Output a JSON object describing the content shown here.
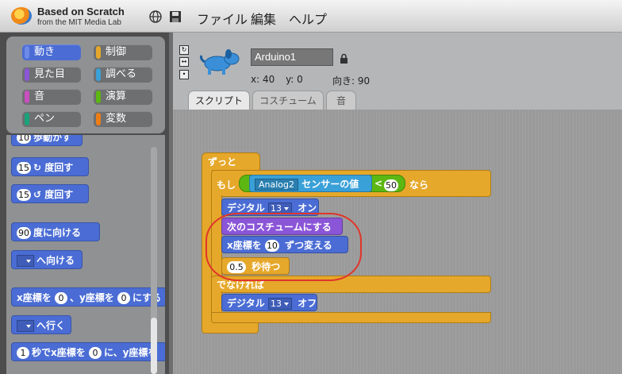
{
  "app": {
    "title": "Based on Scratch",
    "subtitle": "from the MIT Media Lab"
  },
  "menu": {
    "file": "ファイル",
    "edit": "編集",
    "help": "ヘルプ"
  },
  "categories": [
    {
      "label": "動き",
      "color": "#4a6cd4"
    },
    {
      "label": "制御",
      "color": "#e6a82a"
    },
    {
      "label": "見た目",
      "color": "#8a55d7"
    },
    {
      "label": "調べる",
      "color": "#3aa0d8"
    },
    {
      "label": "音",
      "color": "#c94fc0"
    },
    {
      "label": "演算",
      "color": "#5cb712"
    },
    {
      "label": "ペン",
      "color": "#1aa27a"
    },
    {
      "label": "変数",
      "color": "#ee7d16"
    }
  ],
  "palette": {
    "b0_text": "歩動かす",
    "b1_num": "15",
    "b1_text": "度回す",
    "b2_num": "15",
    "b2_text": "度回す",
    "b3_num": "90",
    "b3_text": "度に向ける",
    "b4_text": "へ向ける",
    "b5_a": "x座標を",
    "b5_n1": "0",
    "b5_b": "、y座標を",
    "b5_n2": "0",
    "b5_c": "にする",
    "b6_text": "へ行く",
    "b7_n1": "1",
    "b7_a": "秒でx座標を",
    "b7_n2": "0",
    "b7_b": "に、y座標を"
  },
  "sprite": {
    "name": "Arduino1",
    "x_label": "x: 40",
    "y_label": "y: 0",
    "direction_label": "向き: 90"
  },
  "tabs": {
    "script": "スクリプト",
    "costume": "コスチューム",
    "sound": "音"
  },
  "script": {
    "forever": "ずっと",
    "if": "もし",
    "sensor_dropdown": "Analog2",
    "sensor_text": "センサーの値",
    "lt": "<",
    "compare_value": "50",
    "then": "なら",
    "digital_on_label": "デジタル",
    "digital_on_pin": "13",
    "digital_on_state": "オン",
    "next_costume": "次のコスチュームにする",
    "change_x": "x座標を",
    "change_x_value": "10",
    "change_x_suffix": "ずつ変える",
    "wait_value": "0.5",
    "wait_text": "秒待つ",
    "else": "でなければ",
    "digital_off_label": "デジタル",
    "digital_off_pin": "13",
    "digital_off_state": "オフ"
  }
}
